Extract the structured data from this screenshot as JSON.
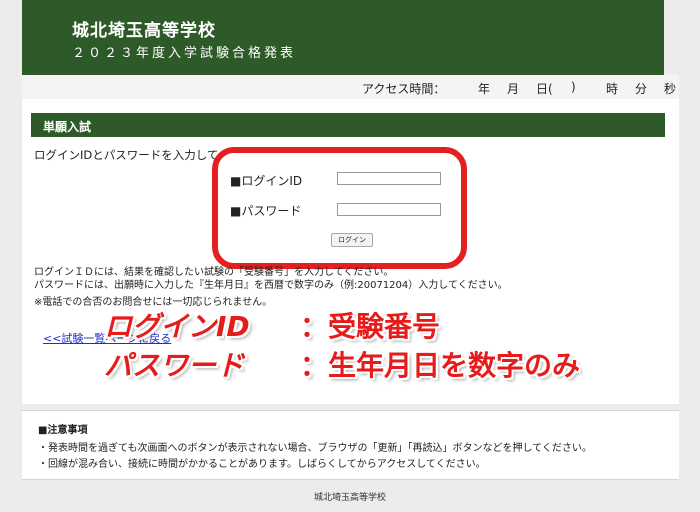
{
  "header": {
    "school_name": "城北埼玉高等学校",
    "exam_title": "２０２３年度入学試験合格発表"
  },
  "access_bar": {
    "label": "アクセス時間：",
    "units": [
      "年",
      "月",
      "日(",
      ")",
      "時",
      "分",
      "秒"
    ]
  },
  "section": {
    "title": "単願入試"
  },
  "login": {
    "intro": "ログインIDとパスワードを入力してください。",
    "id_label": "■ログインID",
    "password_label": "■パスワード",
    "id_value": "",
    "password_value": "",
    "button_label": "ログイン"
  },
  "notes": {
    "line1": "ログインＩＤには、結果を確認したい試験の「受験番号」を入力してください。",
    "line2": "パスワードには、出願時に入力した『生年月日』を西暦で数字のみ（例:20071204）入力してください。",
    "line3": "※電話での合否のお問合せには一切応じられません。"
  },
  "back_link": "<<試験一覧ページに戻る",
  "overlay": {
    "row1_key": "ログインID",
    "row1_value": "：受験番号",
    "row2_key": "パスワード",
    "row2_value": "：生年月日を数字のみ"
  },
  "notice": {
    "title": "■注意事項",
    "line1": "・発表時間を過ぎても次画面へのボタンが表示されない場合、ブラウザの「更新」「再読込」ボタンなどを押してください。",
    "line2": "・回線が混み合い、接続に時間がかかることがあります。しばらくしてからアクセスしてください。"
  },
  "footer": "城北埼玉高等学校",
  "colors": {
    "brand_green": "#2e5a2a",
    "highlight_red": "#e32020",
    "link_blue": "#1d2fd0"
  }
}
